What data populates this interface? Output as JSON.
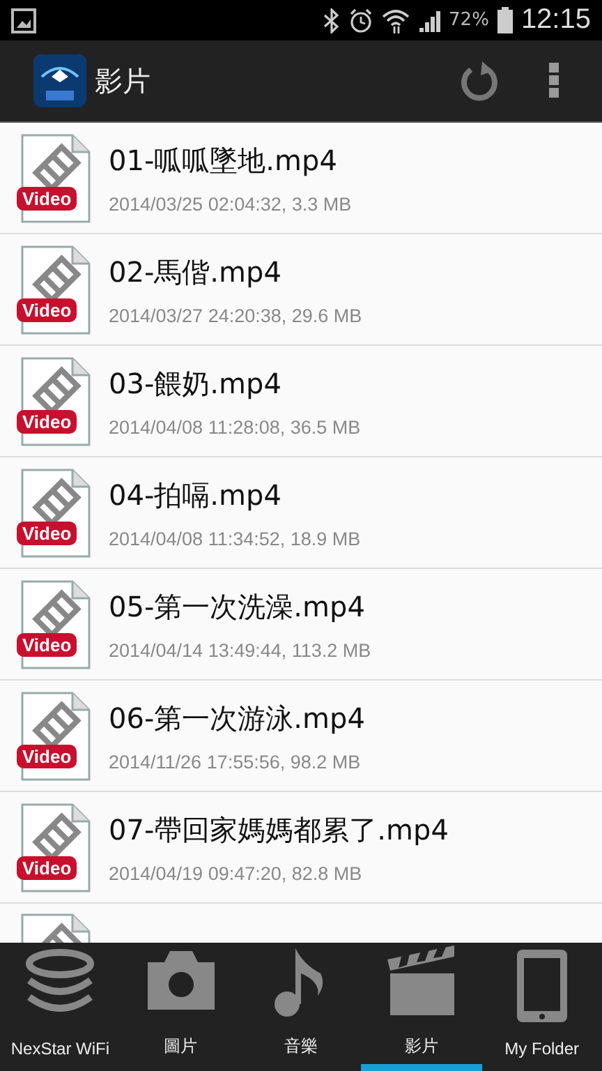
{
  "status_bar": {
    "battery": "72%",
    "time": "12:15"
  },
  "app_bar": {
    "title": "影片"
  },
  "files": [
    {
      "name": "01-呱呱墜地.mp4",
      "meta": "2014/03/25 02:04:32, 3.3 MB",
      "badge": "Video"
    },
    {
      "name": "02-馬偕.mp4",
      "meta": "2014/03/27 24:20:38, 29.6 MB",
      "badge": "Video"
    },
    {
      "name": "03-餵奶.mp4",
      "meta": "2014/04/08 11:28:08, 36.5 MB",
      "badge": "Video"
    },
    {
      "name": "04-拍嗝.mp4",
      "meta": "2014/04/08 11:34:52, 18.9 MB",
      "badge": "Video"
    },
    {
      "name": "05-第一次洗澡.mp4",
      "meta": "2014/04/14 13:49:44, 113.2 MB",
      "badge": "Video"
    },
    {
      "name": "06-第一次游泳.mp4",
      "meta": "2014/11/26 17:55:56, 98.2 MB",
      "badge": "Video"
    },
    {
      "name": "07-帶回家媽媽都累了.mp4",
      "meta": "2014/04/19 09:47:20, 82.8 MB",
      "badge": "Video"
    }
  ],
  "nav": [
    {
      "kind": "database",
      "label": "NexStar WiFi",
      "selected": false
    },
    {
      "kind": "camera",
      "label": "圖片",
      "selected": false
    },
    {
      "kind": "music",
      "label": "音樂",
      "selected": false
    },
    {
      "kind": "clapper",
      "label": "影片",
      "selected": true
    },
    {
      "kind": "tablet",
      "label": "My Folder",
      "selected": false
    }
  ]
}
